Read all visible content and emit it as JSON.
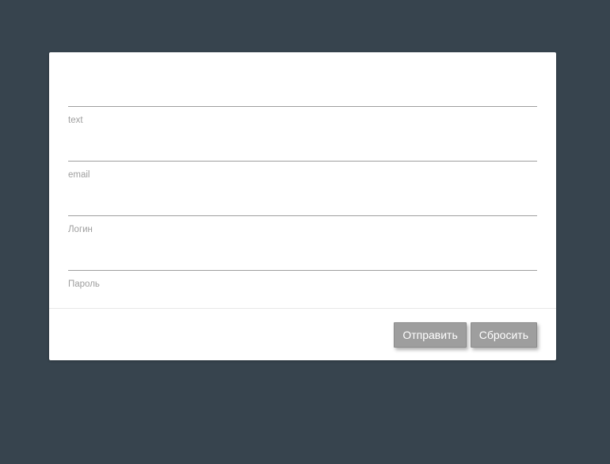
{
  "form": {
    "fields": [
      {
        "label": "text",
        "value": "",
        "placeholder": ""
      },
      {
        "label": "email",
        "value": "",
        "placeholder": ""
      },
      {
        "label": "Логин",
        "value": "",
        "placeholder": ""
      },
      {
        "label": "Пароль",
        "value": "",
        "placeholder": ""
      }
    ],
    "buttons": {
      "submit_label": "Отправить",
      "reset_label": "Сбросить"
    }
  },
  "colors": {
    "page_background": "#37444e",
    "card_background": "#ffffff",
    "button_background": "#9e9e9e",
    "label_text": "#9e9e9e"
  }
}
